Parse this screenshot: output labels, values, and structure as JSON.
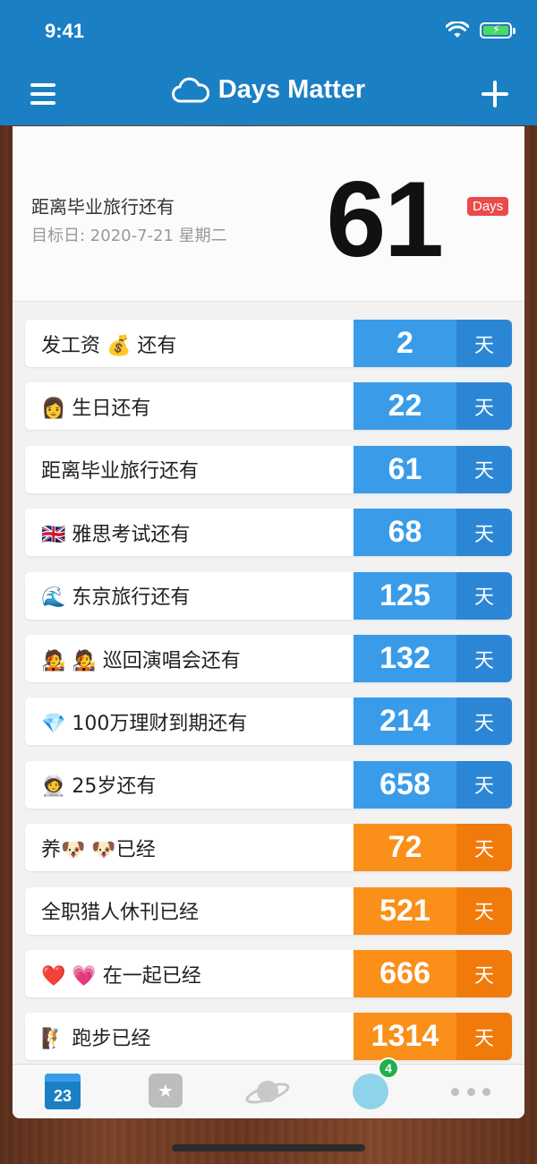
{
  "status": {
    "time": "9:41"
  },
  "header": {
    "title": "Days Matter"
  },
  "hero": {
    "title": "距离毕业旅行还有",
    "date": "目标日: 2020-7-21 星期二",
    "number": "61",
    "badge": "Days"
  },
  "events": [
    {
      "label": "发工资 💰 还有",
      "icon": "money-bag-icon",
      "value": "2",
      "unit": "天",
      "color": "blue"
    },
    {
      "label": "👩 生日还有",
      "icon": "person-icon",
      "value": "22",
      "unit": "天",
      "color": "blue"
    },
    {
      "label": "距离毕业旅行还有",
      "icon": "",
      "value": "61",
      "unit": "天",
      "color": "blue"
    },
    {
      "label": "🇬🇧 雅思考试还有",
      "icon": "uk-flag-icon",
      "value": "68",
      "unit": "天",
      "color": "blue"
    },
    {
      "label": "🌊 东京旅行还有",
      "icon": "wave-icon",
      "value": "125",
      "unit": "天",
      "color": "blue"
    },
    {
      "label": "🧑‍🎤 🧑‍🎤 巡回演唱会还有",
      "icon": "singer-icon",
      "value": "132",
      "unit": "天",
      "color": "blue"
    },
    {
      "label": "💎 100万理财到期还有",
      "icon": "diamond-icon",
      "value": "214",
      "unit": "天",
      "color": "blue"
    },
    {
      "label": "🧑‍🚀 25岁还有",
      "icon": "astronaut-icon",
      "value": "658",
      "unit": "天",
      "color": "blue"
    },
    {
      "label": "养🐶 🐶已经",
      "icon": "dog-icon",
      "value": "72",
      "unit": "天",
      "color": "orange"
    },
    {
      "label": "全职猎人休刊已经",
      "icon": "",
      "value": "521",
      "unit": "天",
      "color": "orange"
    },
    {
      "label": "❤️ 💗 在一起已经",
      "icon": "heart-icon",
      "value": "666",
      "unit": "天",
      "color": "orange"
    },
    {
      "label": "🧗 跑步已经",
      "icon": "runner-icon",
      "value": "1314",
      "unit": "天",
      "color": "orange"
    }
  ],
  "tabbar": {
    "calendar_day": "23",
    "notification_count": "4"
  },
  "colors": {
    "header": "#1b7fc4",
    "blue_num": "#3a9ce9",
    "blue_unit": "#2c86d6",
    "orange_num": "#fa8f19",
    "orange_unit": "#f07a0a",
    "badge_red": "#e94b4b"
  }
}
